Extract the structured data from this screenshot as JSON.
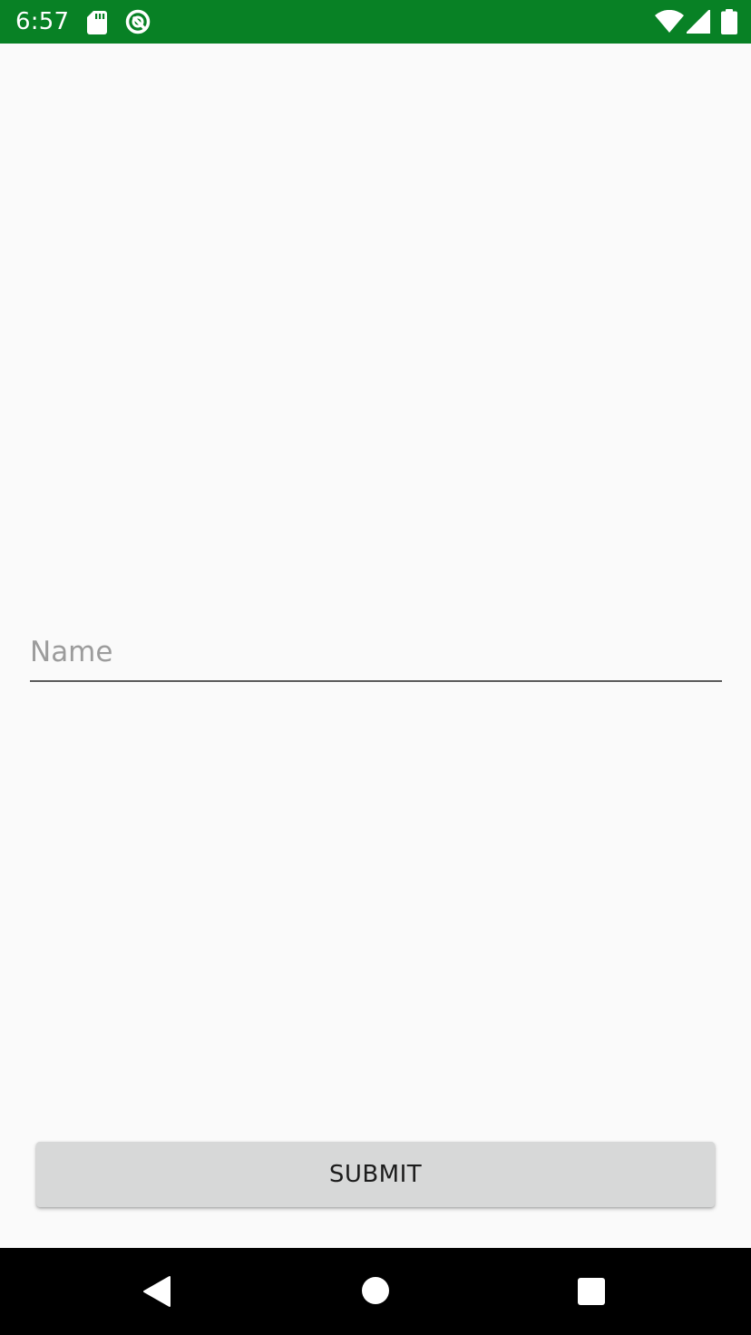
{
  "status_bar": {
    "time": "6:57",
    "background_color": "#088125",
    "icons": [
      "sd-card-icon",
      "data-saver-icon",
      "wifi-icon",
      "cell-signal-icon",
      "battery-icon"
    ]
  },
  "form": {
    "name_field": {
      "placeholder": "Name",
      "value": ""
    },
    "submit_label": "SUBMIT"
  },
  "nav_bar": {
    "buttons": [
      "back-icon",
      "home-icon",
      "recents-icon"
    ]
  }
}
